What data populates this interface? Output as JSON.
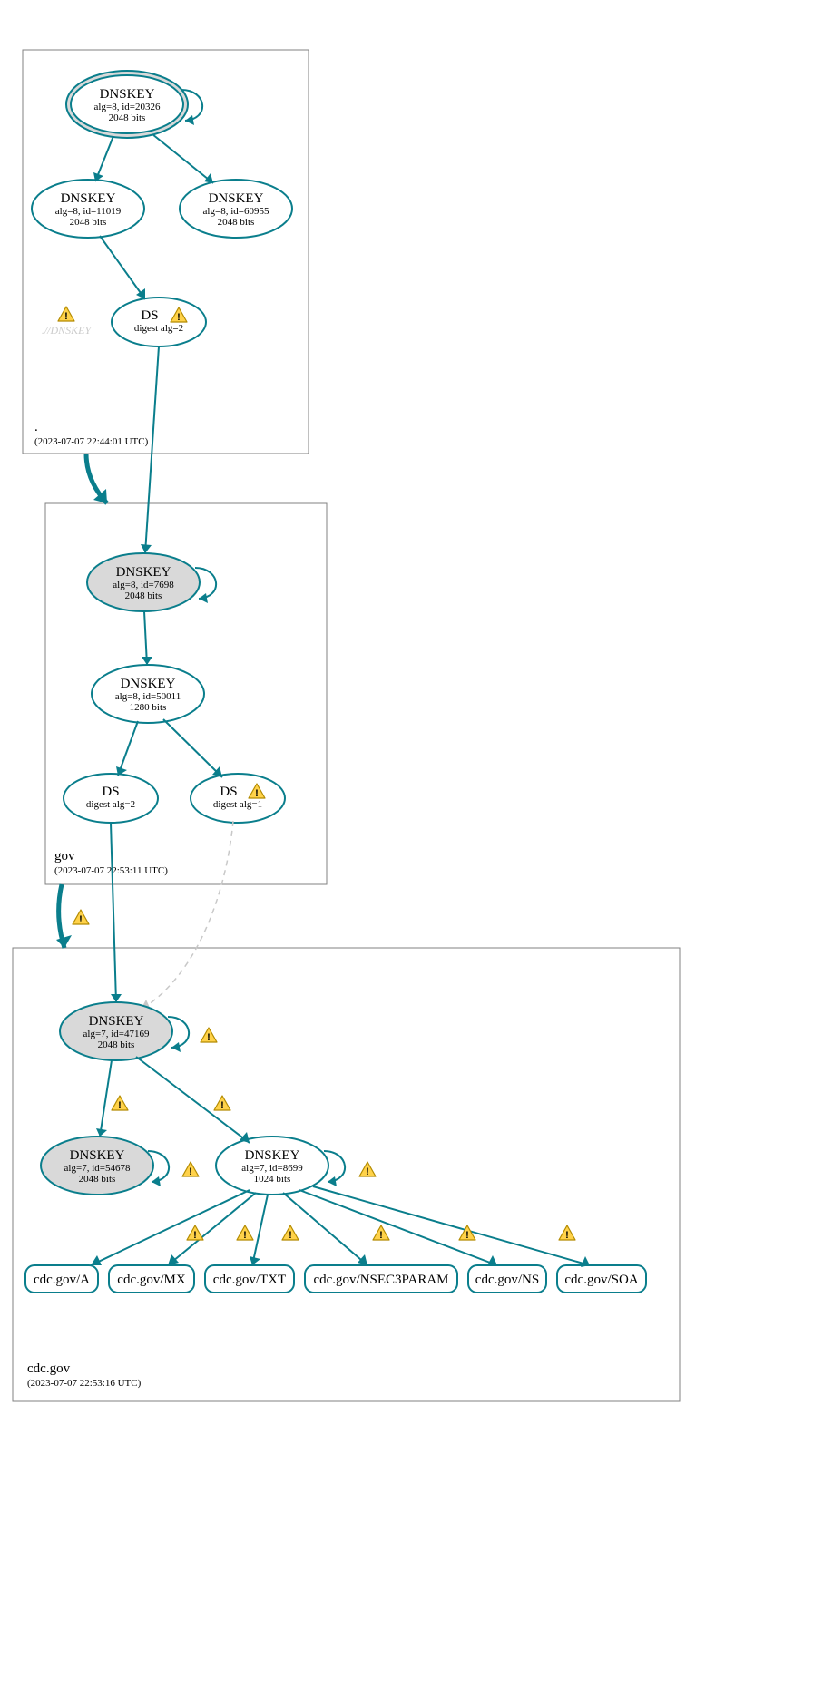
{
  "zones": {
    "root": {
      "name": ".",
      "timestamp": "(2023-07-07 22:44:01 UTC)"
    },
    "gov": {
      "name": "gov",
      "timestamp": "(2023-07-07 22:53:11 UTC)"
    },
    "cdcgov": {
      "name": "cdc.gov",
      "timestamp": "(2023-07-07 22:53:16 UTC)"
    }
  },
  "nodes": {
    "root_ksk": {
      "title": "DNSKEY",
      "sub1": "alg=8, id=20326",
      "sub2": "2048 bits"
    },
    "root_zsk1": {
      "title": "DNSKEY",
      "sub1": "alg=8, id=11019",
      "sub2": "2048 bits"
    },
    "root_zsk2": {
      "title": "DNSKEY",
      "sub1": "alg=8, id=60955",
      "sub2": "2048 bits"
    },
    "root_ghost": {
      "label": ".//DNSKEY"
    },
    "root_ds": {
      "title": "DS",
      "sub1": "digest alg=2"
    },
    "gov_ksk": {
      "title": "DNSKEY",
      "sub1": "alg=8, id=7698",
      "sub2": "2048 bits"
    },
    "gov_zsk": {
      "title": "DNSKEY",
      "sub1": "alg=8, id=50011",
      "sub2": "1280 bits"
    },
    "gov_ds1": {
      "title": "DS",
      "sub1": "digest alg=2"
    },
    "gov_ds2": {
      "title": "DS",
      "sub1": "digest alg=1"
    },
    "cdc_ksk": {
      "title": "DNSKEY",
      "sub1": "alg=7, id=47169",
      "sub2": "2048 bits"
    },
    "cdc_zsk1": {
      "title": "DNSKEY",
      "sub1": "alg=7, id=54678",
      "sub2": "2048 bits"
    },
    "cdc_zsk2": {
      "title": "DNSKEY",
      "sub1": "alg=7, id=8699",
      "sub2": "1024 bits"
    },
    "rr_a": {
      "label": "cdc.gov/A"
    },
    "rr_mx": {
      "label": "cdc.gov/MX"
    },
    "rr_txt": {
      "label": "cdc.gov/TXT"
    },
    "rr_n3p": {
      "label": "cdc.gov/NSEC3PARAM"
    },
    "rr_ns": {
      "label": "cdc.gov/NS"
    },
    "rr_soa": {
      "label": "cdc.gov/SOA"
    }
  }
}
